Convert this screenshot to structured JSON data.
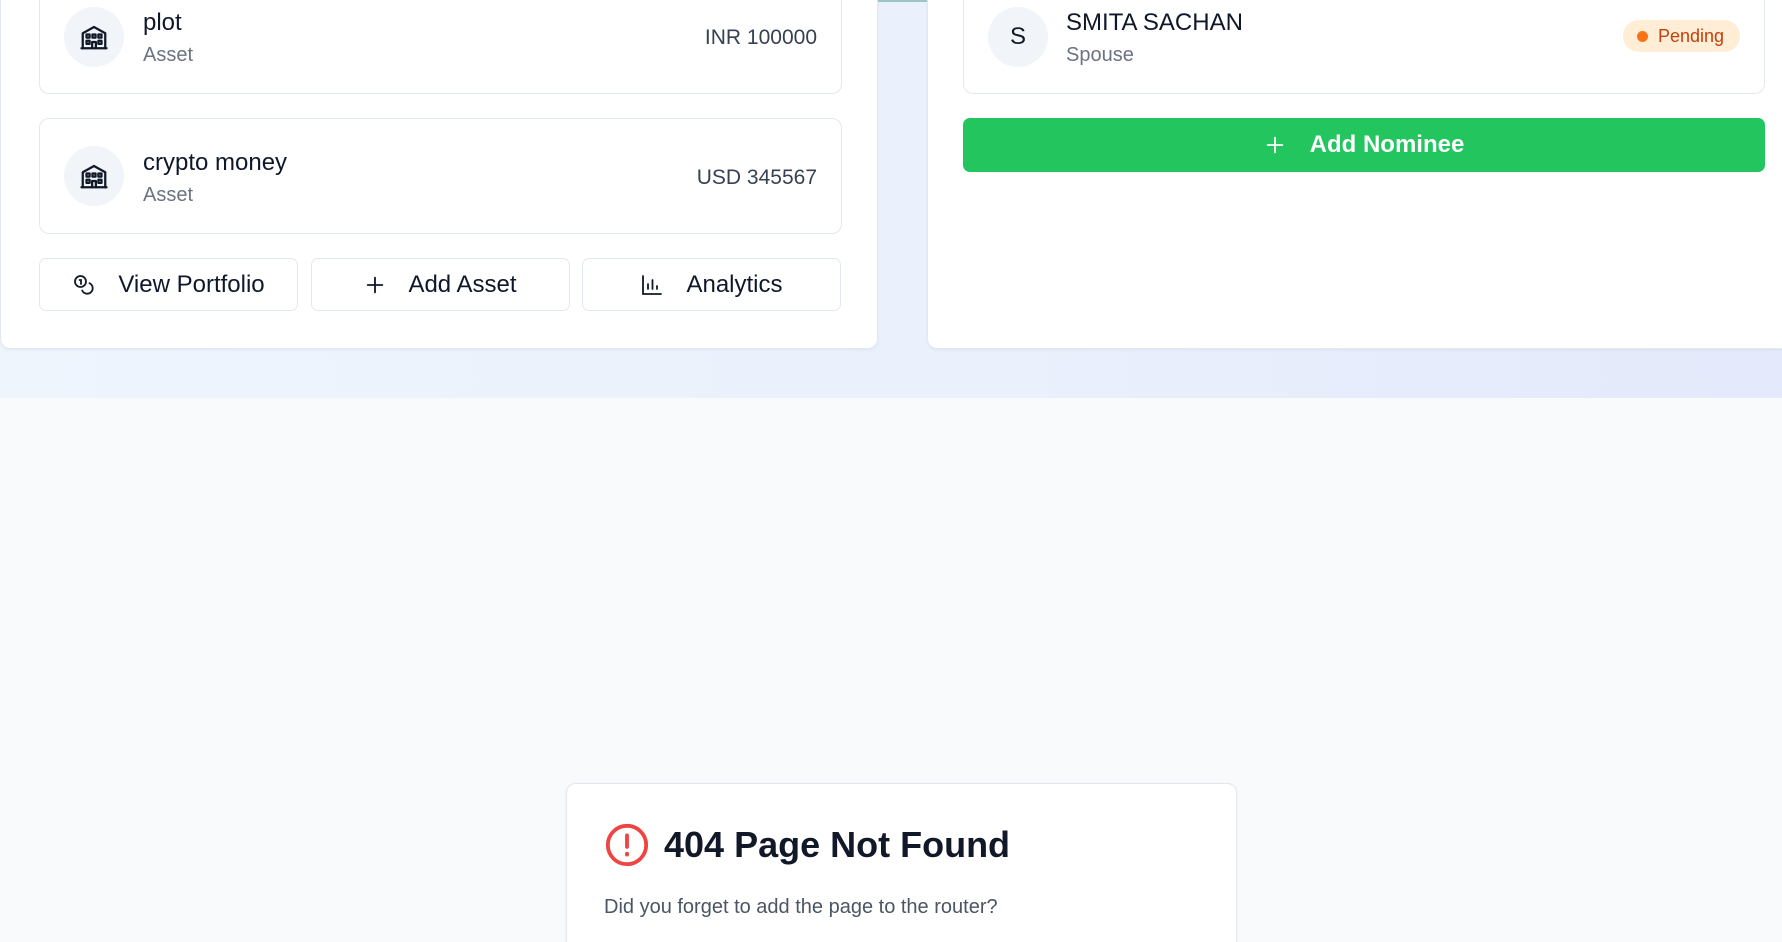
{
  "assets": {
    "items": [
      {
        "title": "plot",
        "type": "Asset",
        "amount": "INR 100000",
        "icon": "building-icon"
      },
      {
        "title": "crypto money",
        "type": "Asset",
        "amount": "USD 345567",
        "icon": "building-icon"
      }
    ],
    "actions": {
      "view_portfolio": "View Portfolio",
      "add_asset": "Add Asset",
      "analytics": "Analytics"
    }
  },
  "nominees": {
    "items": [
      {
        "initial": "S",
        "name": "SMITA SACHAN",
        "relation": "Spouse",
        "status": "Pending"
      }
    ],
    "add_label": "Add Nominee"
  },
  "not_found": {
    "title": "404 Page Not Found",
    "message": "Did you forget to add the page to the router?"
  },
  "colors": {
    "accent_green": "#22c55e",
    "pending_bg": "#ffedd5",
    "pending_text": "#c2410c",
    "error_red": "#ef4444"
  }
}
